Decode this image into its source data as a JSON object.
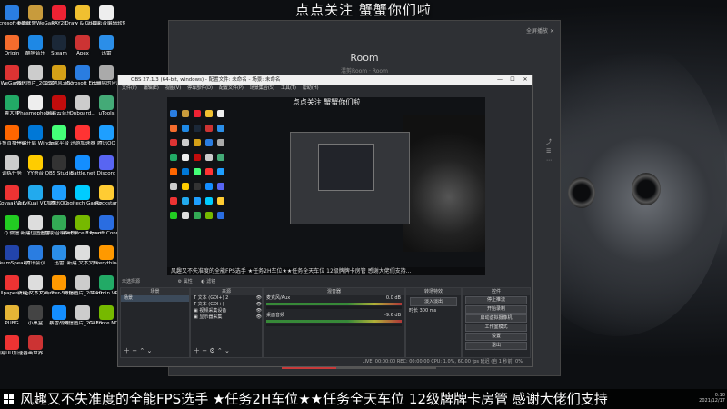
{
  "banner": "点点关注 蟹蟹你们啦",
  "ticker": "风趣又不失准度的全能FPS选手 ★任务2H车位★★任务全天车位 12级牌牌卡房管 感谢大佬们支持",
  "player": {
    "title": "Room",
    "subtitle": "混剪Room · Room",
    "controls": "全屏播放"
  },
  "desktop_icons": [
    {
      "label": "Microsoft Edge",
      "color": "#2a7de1"
    },
    {
      "label": "英雄联盟WeGame平台",
      "color": "#c89b3c"
    },
    {
      "label": "RAY2E",
      "color": "#e23"
    },
    {
      "label": "Draw & Guess",
      "color": "#f0c030"
    },
    {
      "label": "迅雷影音编辑软件",
      "color": "#eee"
    },
    {
      "label": "Origin",
      "color": "#f56c2d"
    },
    {
      "label": "酷狗音乐",
      "color": "#1e88e5"
    },
    {
      "label": "Steam",
      "color": "#1b2838"
    },
    {
      "label": "Apex",
      "color": "#c33"
    },
    {
      "label": "迅雷",
      "color": "#2b8ee8"
    },
    {
      "label": "WeGame",
      "color": "#d33"
    },
    {
      "label": "微信图片_2021001...",
      "color": "#ccc"
    },
    {
      "label": "《战地风云5》",
      "color": "#d4a017"
    },
    {
      "label": "Microsoft Edge",
      "color": "#2a7de1"
    },
    {
      "label": "已删除的应用",
      "color": "#aaa"
    },
    {
      "label": "鲁大师",
      "color": "#2a6"
    },
    {
      "label": "Phasmophobia",
      "color": "#eee"
    },
    {
      "label": "网易云音乐",
      "color": "#c20c0c"
    },
    {
      "label": "Onboard...",
      "color": "#ccc"
    },
    {
      "label": "uTools",
      "color": "#4a7"
    },
    {
      "label": "斗鱼直播伴侣",
      "color": "#f60"
    },
    {
      "label": "一键开启 Windows...",
      "color": "#0078d7"
    },
    {
      "label": "玩家平台",
      "color": "#4f7"
    },
    {
      "label": "迅游加速器",
      "color": "#f33"
    },
    {
      "label": "腾讯QQ",
      "color": "#1e9fff"
    },
    {
      "label": "训练任务",
      "color": "#ccc"
    },
    {
      "label": "YY语音",
      "color": "#fc0"
    },
    {
      "label": "OBS Studio",
      "color": "#333"
    },
    {
      "label": "Battle.net",
      "color": "#148eff"
    },
    {
      "label": "Discord",
      "color": "#5865f2"
    },
    {
      "label": "Kovaak 2.0",
      "color": "#e33"
    },
    {
      "label": "VeryKuai VK加速器",
      "color": "#2ae"
    },
    {
      "label": "腾讯QQ",
      "color": "#1e9fff"
    },
    {
      "label": "Logitech Gaming",
      "color": "#0cf"
    },
    {
      "label": "Rockstar",
      "color": "#fc3"
    },
    {
      "label": "Q 微信",
      "color": "#2c2"
    },
    {
      "label": "新建位图图像",
      "color": "#ddd"
    },
    {
      "label": "迅雷影音编辑软件",
      "color": "#3a5"
    },
    {
      "label": "GeForce Experience",
      "color": "#76b900"
    },
    {
      "label": "Ubisoft Connect",
      "color": "#2a6de1"
    },
    {
      "label": "TeamSpeak",
      "color": "#24a"
    },
    {
      "label": "腾讯会议",
      "color": "#2a7de1"
    },
    {
      "label": "迅雷",
      "color": "#2b8ee8"
    },
    {
      "label": "新建 文本文档",
      "color": "#ddd"
    },
    {
      "label": "Everything",
      "color": "#f90"
    },
    {
      "label": "Wallpaper Engine",
      "color": "#e33"
    },
    {
      "label": "新建 文本文档 2",
      "color": "#ddd"
    },
    {
      "label": "Counter-Strike Global Off...",
      "color": "#f90"
    },
    {
      "label": "微信图片_2021001...",
      "color": "#ccc"
    },
    {
      "label": "Radmin VPN",
      "color": "#2a6"
    },
    {
      "label": "PUBG",
      "color": "#e5b536"
    },
    {
      "label": "小黑盒",
      "color": "#444"
    },
    {
      "label": "暴雪战网",
      "color": "#148eff"
    },
    {
      "label": "微信图片_2021001...",
      "color": "#ccc"
    },
    {
      "label": "GeForce NOW",
      "color": "#76b900"
    },
    {
      "label": "网易UU加速器",
      "color": "#e33"
    },
    {
      "label": "画世界",
      "color": "#c33"
    }
  ],
  "obs": {
    "window_title": "OBS 27.1.3 (64-bit, windows) - 配置文件: 未命名 - 场景: 未命名",
    "menu": [
      "文件(F)",
      "编辑(E)",
      "视图(V)",
      "停靠部件(D)",
      "配置文件(P)",
      "场景集合(S)",
      "工具(T)",
      "帮助(H)"
    ],
    "preview_banner": "点点关注 蟹蟹你们啦",
    "preview_ticker": "风趣又不失准度的全能FPS选手 ★任务2H车位★★任务全天车位 12级牌牌卡房管 感谢大佬们支持...",
    "toolbar_left": "未选择源",
    "toolbar_props": "属性",
    "toolbar_filters": "滤镜",
    "panels": {
      "scenes_header": "场景",
      "scene_item": "场景",
      "sources_header": "来源",
      "sources": [
        "文本 (GDI+) 2",
        "文本 (GDI+)",
        "视频采集设备",
        "显示器采集"
      ],
      "mixer_header": "混音器",
      "mixer_channels": [
        {
          "name": "麦克风/Aux",
          "db": "0.0 dB"
        },
        {
          "name": "桌面音频",
          "db": "-9.6 dB"
        }
      ],
      "transition_header": "转场特效",
      "transition_value": "淡入淡出",
      "duration_label": "时长",
      "duration_value": "300 ms",
      "controls_header": "控件",
      "controls": [
        "停止推流",
        "开始录制",
        "启动虚拟摄像机",
        "工作室模式",
        "设置",
        "退出"
      ]
    },
    "status": "LIVE: 00:00:00  REC: 00:00:00  CPU: 1.0%, 60.00 fps  延迟 (自 1 秒前) 0%"
  },
  "tray": {
    "time": "0:10",
    "date": "2021/12/17"
  }
}
